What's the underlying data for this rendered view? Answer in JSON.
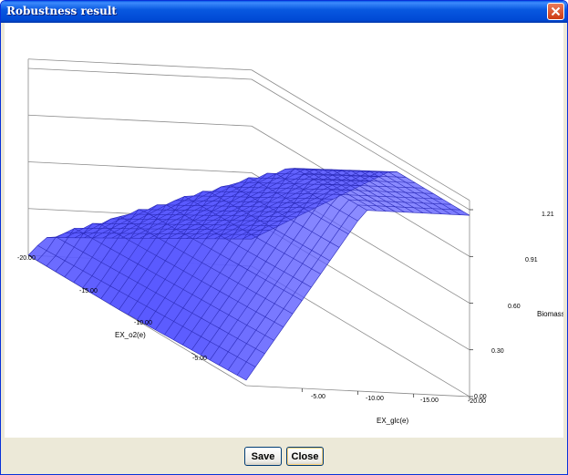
{
  "window": {
    "title": "Robustness result"
  },
  "chart_data": {
    "type": "surface",
    "x_axis": {
      "label": "EX_o2(e)",
      "ticks": [
        "-20.00",
        "-15.00",
        "-10.00",
        "-5.00"
      ]
    },
    "y_axis": {
      "label": "EX_glc(e)",
      "ticks": [
        "-5.00",
        "-10.00",
        "-15.00",
        "-20.00"
      ]
    },
    "z_axis": {
      "label": "Biomass",
      "ticks": [
        "0.00",
        "0.30",
        "0.60",
        "0.91",
        "1.21"
      ],
      "zlim": [
        0,
        1.21
      ]
    },
    "surface_color": "#5a5aff",
    "grid_color": "#2a2ab8"
  },
  "buttons": {
    "save": "Save",
    "close": "Close"
  }
}
